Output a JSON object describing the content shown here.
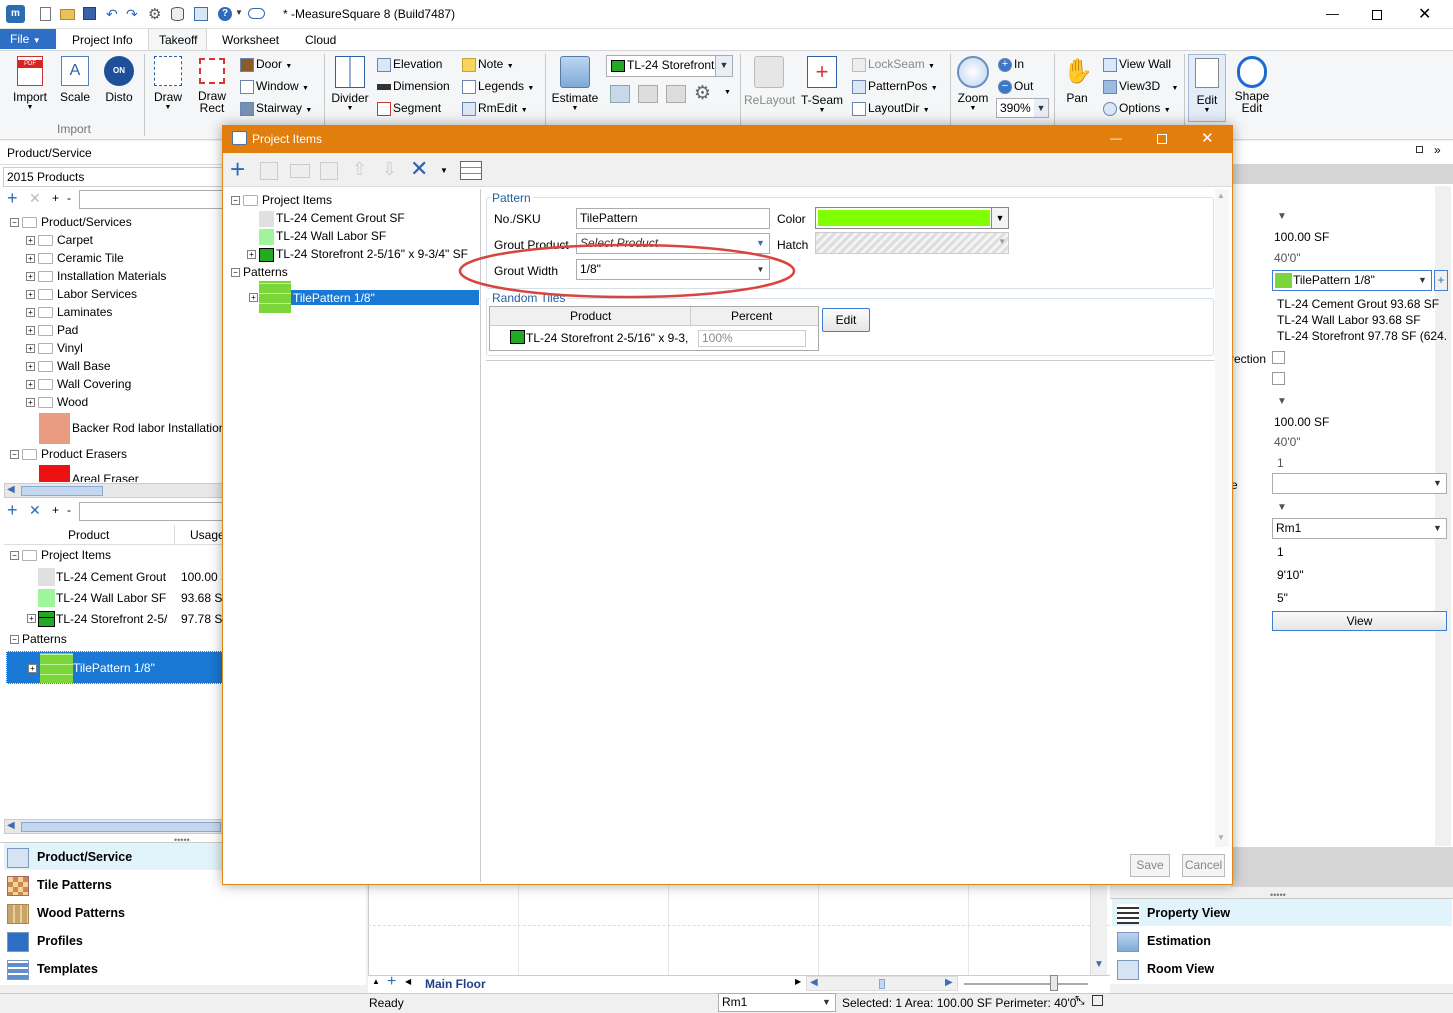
{
  "titlebar": {
    "title": "* -MeasureSquare 8 (Build7487)"
  },
  "ribbon": {
    "file_tab": "File",
    "tabs": [
      "Project Info",
      "Takeoff",
      "Worksheet",
      "Cloud"
    ],
    "import_group": {
      "import": "Import",
      "scale": "Scale",
      "disto": "Disto",
      "group_label": "Import"
    },
    "draw": "Draw",
    "draw_rect": "Draw Rect",
    "door": "Door",
    "window": "Window",
    "stairway": "Stairway",
    "divider": "Divider",
    "elevation": "Elevation",
    "dimension": "Dimension",
    "segment": "Segment",
    "note": "Note",
    "legends": "Legends",
    "rmedit": "RmEdit",
    "estimate": "Estimate",
    "product_select": "TL-24 Storefront",
    "relayout": "ReLayout",
    "tseam": "T-Seam",
    "lockseam": "LockSeam",
    "patternpos": "PatternPos",
    "layoutdir": "LayoutDir",
    "zoom": "Zoom",
    "zoom_in": "In",
    "zoom_out": "Out",
    "zoom_value": "390%",
    "pan": "Pan",
    "view_wall": "View Wall",
    "view3d": "View3D",
    "options": "Options",
    "edit": "Edit",
    "shape_edit": "Shape Edit"
  },
  "left_panel": {
    "header": "Product/Service",
    "catalog": "2015 Products",
    "tree": {
      "root": "Product/Services",
      "items": [
        "Carpet",
        "Ceramic Tile",
        "Installation Materials",
        "Labor Services",
        "Laminates",
        "Pad",
        "Vinyl",
        "Wall Base",
        "Wall Covering",
        "Wood"
      ],
      "backer": "Backer Rod labor Installation",
      "erasers": "Product Erasers",
      "eraser_item": "Areal Eraser"
    },
    "grid": {
      "col_product": "Product",
      "col_usage": "Usage",
      "project_items": "Project Items",
      "rows": [
        {
          "name": "TL-24 Cement Grout",
          "usage": "100.00 S"
        },
        {
          "name": "TL-24 Wall Labor  SF",
          "usage": "93.68 SF"
        },
        {
          "name": "TL-24 Storefront 2-5/",
          "usage": "97.78 SF"
        }
      ],
      "patterns": "Patterns",
      "pattern_item": "TilePattern 1/8\""
    },
    "nav": [
      "Product/Service",
      "Tile Patterns",
      "Wood Patterns",
      "Profiles",
      "Templates"
    ]
  },
  "right_panel": {
    "v1": "100.00 SF",
    "v2": "40'0\"",
    "pattern_select": "TilePattern 1/8\"",
    "list": [
      "TL-24 Cement Grout 93.68 SF",
      "TL-24 Wall Labor 93.68 SF",
      "TL-24 Storefront 97.78 SF (624.5"
    ],
    "direction_label": "rection",
    "v3": "100.00 SF",
    "v4": "40'0\"",
    "v5": "1",
    "label_e": "e",
    "room_select": "Rm1",
    "v6": "1",
    "v7": "9'10\"",
    "v8": "5\"",
    "view_button": "View",
    "nav": [
      "Property View",
      "Estimation",
      "Room View"
    ]
  },
  "canvas": {
    "floor_tab": "Main Floor"
  },
  "statusbar": {
    "ready": "Ready",
    "room": "Rm1",
    "selection": "Selected: 1 Area: 100.00 SF Perimeter: 40'0\""
  },
  "dialog": {
    "title": "Project Items",
    "tree": {
      "project_items": "Project Items",
      "items": [
        "TL-24 Cement Grout  SF",
        "TL-24 Wall Labor  SF",
        "TL-24 Storefront 2-5/16\" x 9-3/4\" SF"
      ],
      "patterns": "Patterns",
      "pattern_item": "TilePattern 1/8\""
    },
    "pattern_group": "Pattern",
    "sku_label": "No./SKU",
    "sku_value": "TilePattern",
    "color_label": "Color",
    "color_value": "#80ff00",
    "grout_product_label": "Grout Product",
    "grout_product_placeholder": "Select Product",
    "hatch_label": "Hatch",
    "grout_width_label": "Grout Width",
    "grout_width_value": "1/8\"",
    "random_tiles": "Random Tiles",
    "col_product": "Product",
    "col_percent": "Percent",
    "random_row_product": "TL-24 Storefront 2-5/16\" x 9-3,",
    "random_row_percent": "100%",
    "edit_button": "Edit",
    "save_button": "Save",
    "cancel_button": "Cancel"
  }
}
